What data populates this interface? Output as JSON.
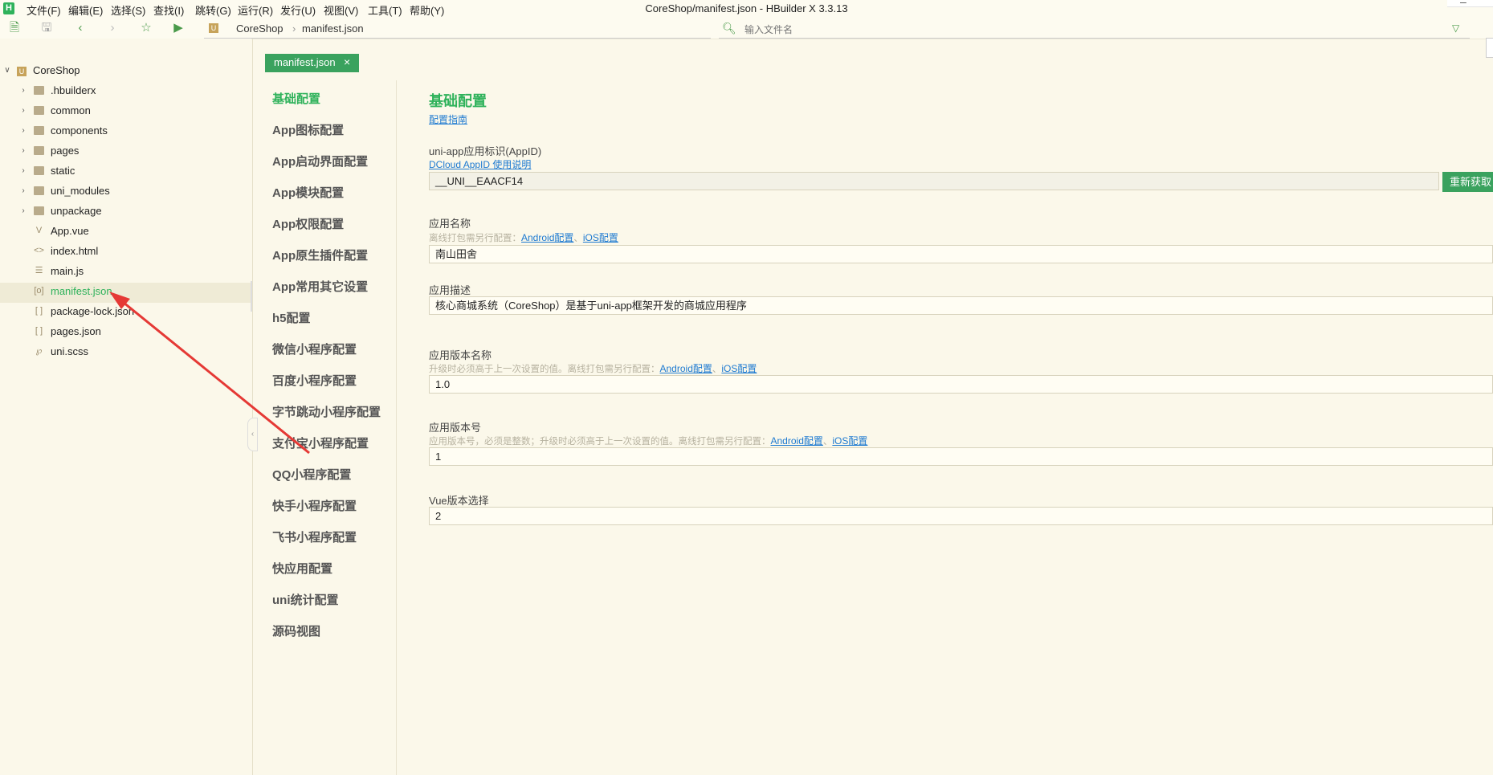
{
  "window": {
    "title": "CoreShop/manifest.json - HBuilder X 3.3.13",
    "app_icon_letter": "H"
  },
  "menu": [
    {
      "label": "文件(F)"
    },
    {
      "label": "编辑(E)"
    },
    {
      "label": "选择(S)"
    },
    {
      "label": "查找(I)"
    },
    {
      "label": "跳转(G)"
    },
    {
      "label": "运行(R)"
    },
    {
      "label": "发行(U)"
    },
    {
      "label": "视图(V)"
    },
    {
      "label": "工具(T)"
    },
    {
      "label": "帮助(Y)"
    }
  ],
  "toolbar": {
    "breadcrumb": [
      "CoreShop",
      "manifest.json"
    ],
    "file_search_placeholder": "输入文件名",
    "icons": [
      "new-file-icon",
      "save-icon",
      "back-icon",
      "forward-icon",
      "favorite-icon",
      "run-icon"
    ]
  },
  "sidebar": {
    "root": "CoreShop",
    "items": [
      {
        "label": ".hbuilderx",
        "type": "folder"
      },
      {
        "label": "common",
        "type": "folder"
      },
      {
        "label": "components",
        "type": "folder"
      },
      {
        "label": "pages",
        "type": "folder"
      },
      {
        "label": "static",
        "type": "folder"
      },
      {
        "label": "uni_modules",
        "type": "folder"
      },
      {
        "label": "unpackage",
        "type": "folder"
      },
      {
        "label": "App.vue",
        "type": "vue-file"
      },
      {
        "label": "index.html",
        "type": "html-file"
      },
      {
        "label": "main.js",
        "type": "js-file"
      },
      {
        "label": "manifest.json",
        "type": "json-file",
        "selected": true
      },
      {
        "label": "package-lock.json",
        "type": "json-file"
      },
      {
        "label": "pages.json",
        "type": "json-file"
      },
      {
        "label": "uni.scss",
        "type": "scss-file"
      }
    ]
  },
  "editor": {
    "tab_label": "manifest.json",
    "tab_close": "×"
  },
  "settings_nav": [
    {
      "label": "基础配置",
      "active": true
    },
    {
      "label": "App图标配置"
    },
    {
      "label": "App启动界面配置"
    },
    {
      "label": "App模块配置"
    },
    {
      "label": "App权限配置"
    },
    {
      "label": "App原生插件配置"
    },
    {
      "label": "App常用其它设置"
    },
    {
      "label": "h5配置"
    },
    {
      "label": "微信小程序配置"
    },
    {
      "label": "百度小程序配置"
    },
    {
      "label": "字节跳动小程序配置"
    },
    {
      "label": "支付宝小程序配置"
    },
    {
      "label": "QQ小程序配置"
    },
    {
      "label": "快手小程序配置"
    },
    {
      "label": "飞书小程序配置"
    },
    {
      "label": "快应用配置"
    },
    {
      "label": "uni统计配置"
    },
    {
      "label": "源码视图"
    }
  ],
  "form": {
    "title": "基础配置",
    "guide_link": "配置指南",
    "appid": {
      "label": "uni-app应用标识(AppID)",
      "link": "DCloud AppID 使用说明",
      "value": "__UNI__EAACF14",
      "button": "重新获取"
    },
    "app_name": {
      "label": "应用名称",
      "hint": "离线打包需另行配置：",
      "android_link": "Android配置",
      "separator": "、",
      "ios_link": "iOS配置",
      "value": "南山田舍"
    },
    "description": {
      "label": "应用描述",
      "value": "核心商城系统（CoreShop）是基于uni-app框架开发的商城应用程序"
    },
    "version_name": {
      "label": "应用版本名称",
      "hint": "升级时必须高于上一次设置的值。离线打包需另行配置：",
      "android_link": "Android配置",
      "separator": "、",
      "ios_link": "iOS配置",
      "value": "1.0"
    },
    "version_code": {
      "label": "应用版本号",
      "hint": "应用版本号，必须是整数；升级时必须高于上一次设置的值。离线打包需另行配置：",
      "android_link": "Android配置",
      "separator": "、",
      "ios_link": "iOS配置",
      "value": "1"
    },
    "vue_version": {
      "label": "Vue版本选择",
      "value": "2"
    }
  },
  "colors": {
    "accent": "#3aa25e",
    "background": "#fbf8ea",
    "link": "#1e7ad1",
    "annotation_arrow": "#e53935"
  }
}
